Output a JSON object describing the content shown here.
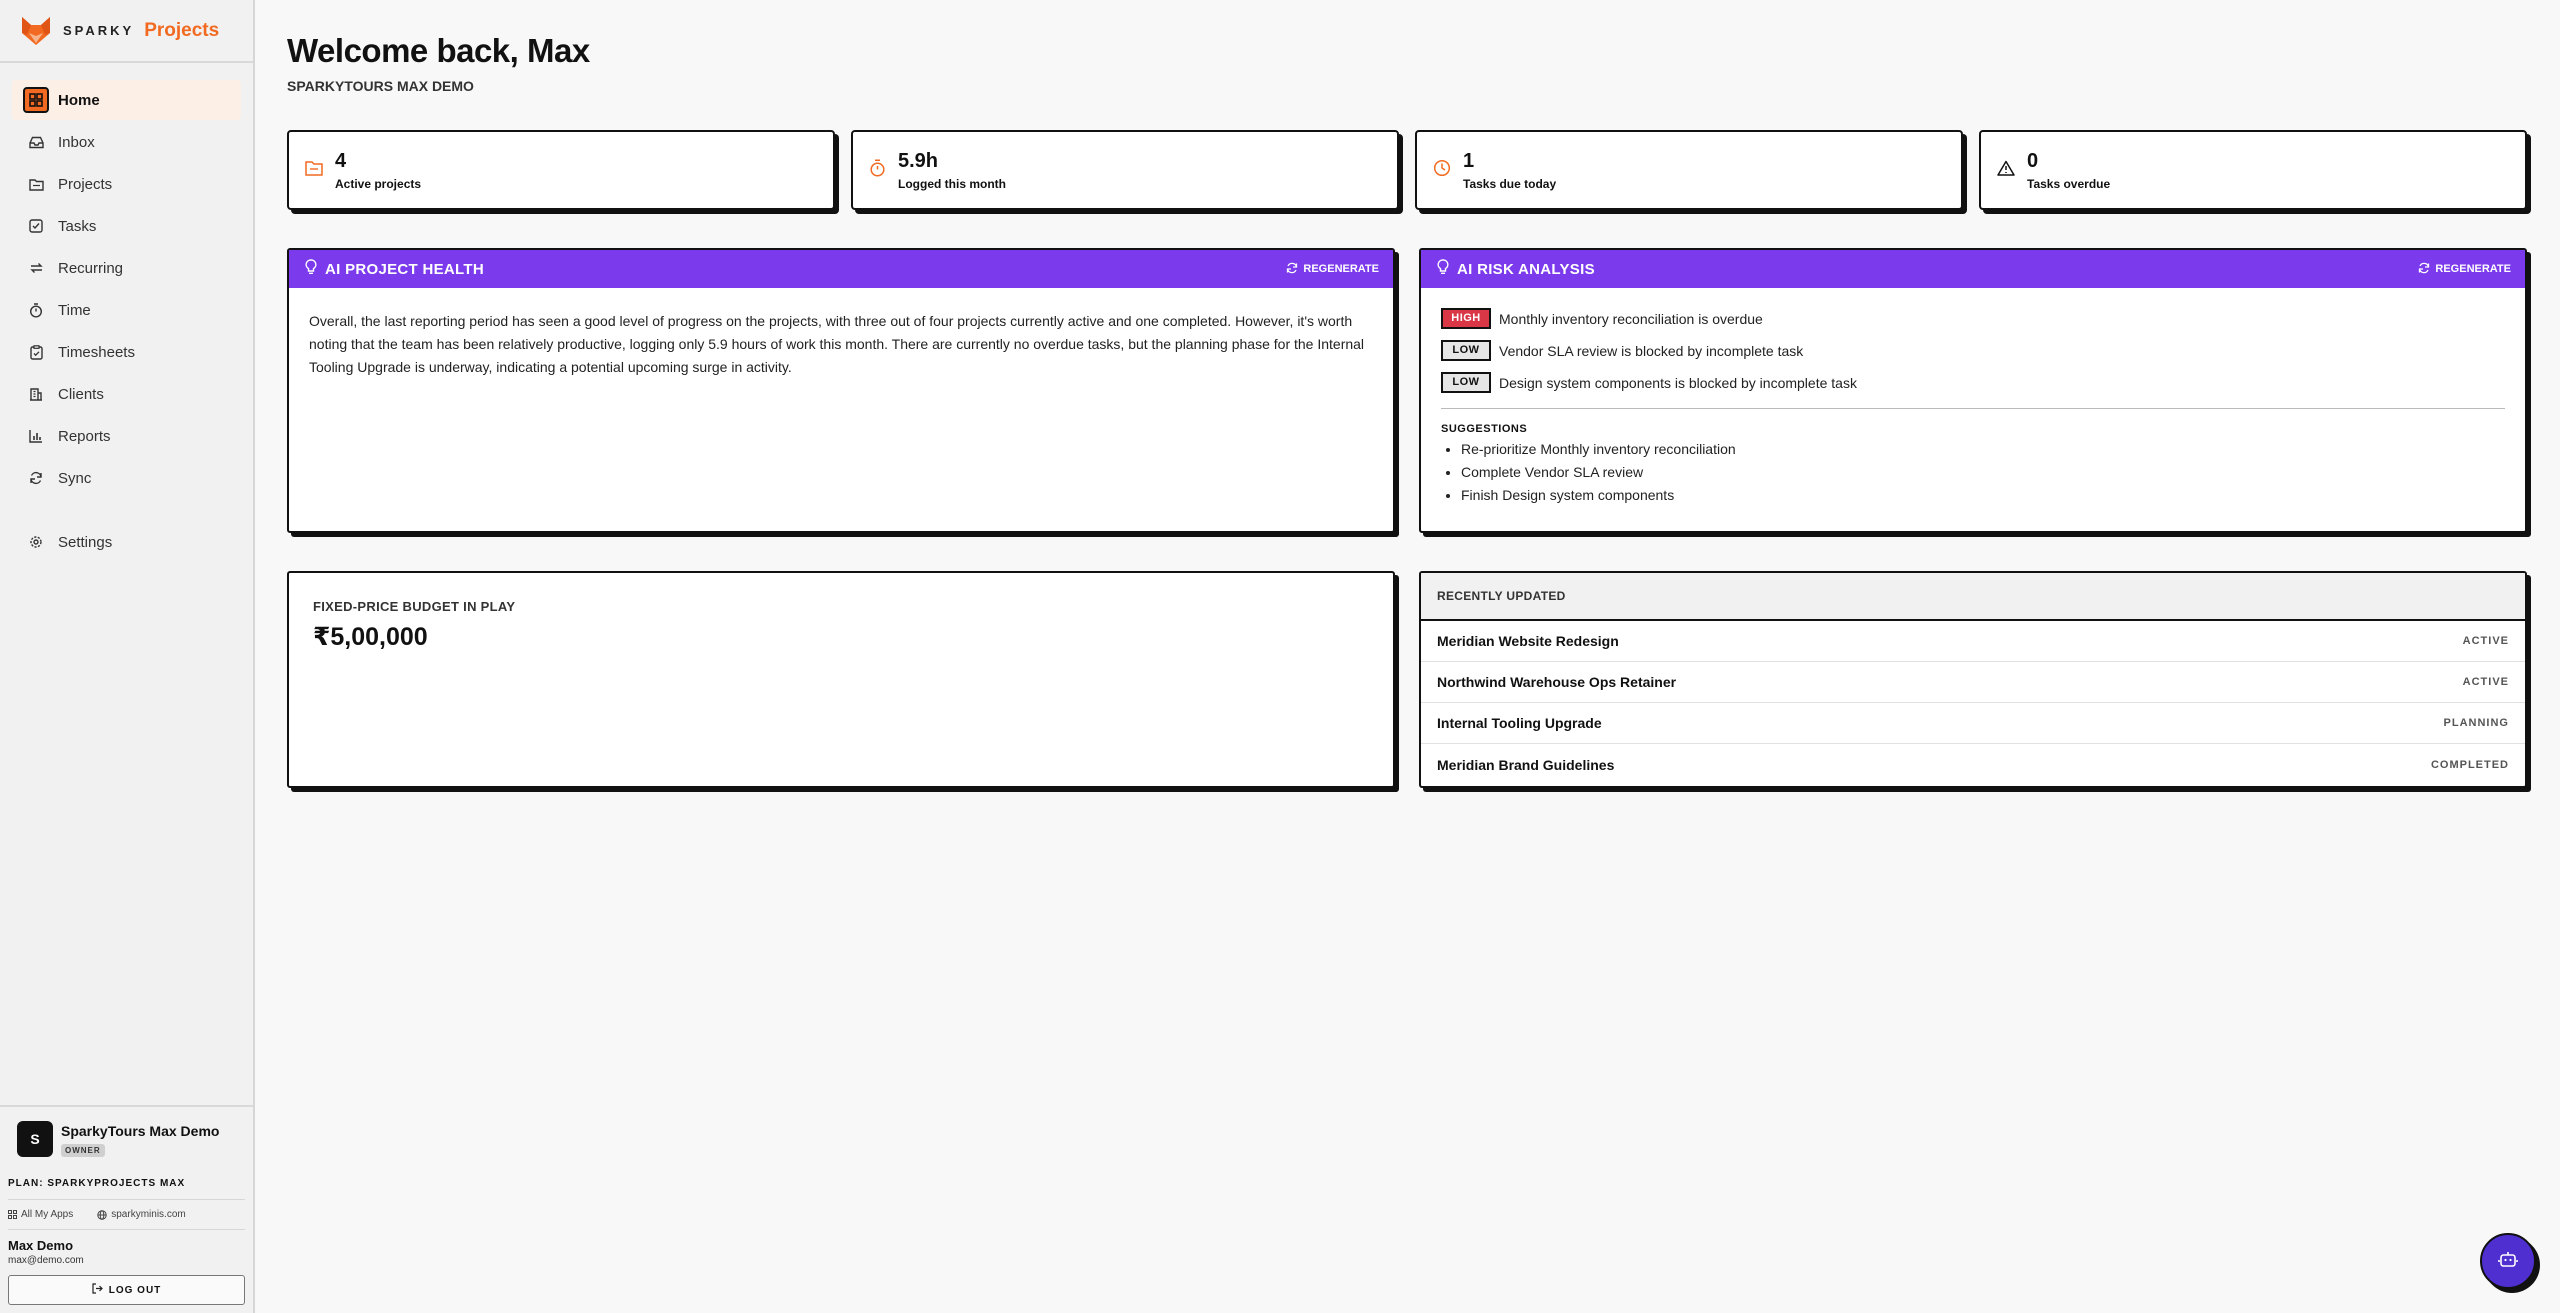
{
  "brand": {
    "sparky": "SPARKY",
    "product": "Projects",
    "logo_icon": "sparky-fox-logo",
    "accent": "#f26a21"
  },
  "nav": [
    {
      "label": "Home",
      "icon": "grid-icon",
      "active": true
    },
    {
      "label": "Inbox",
      "icon": "inbox-icon"
    },
    {
      "label": "Projects",
      "icon": "folder-icon"
    },
    {
      "label": "Tasks",
      "icon": "checkbox-icon"
    },
    {
      "label": "Recurring",
      "icon": "repeat-icon"
    },
    {
      "label": "Time",
      "icon": "stopwatch-icon"
    },
    {
      "label": "Timesheets",
      "icon": "clipboard-icon"
    },
    {
      "label": "Clients",
      "icon": "building-icon"
    },
    {
      "label": "Reports",
      "icon": "bar-chart-icon"
    },
    {
      "label": "Sync",
      "icon": "sync-icon"
    }
  ],
  "settings": {
    "label": "Settings",
    "icon": "gear-icon"
  },
  "org": {
    "initial": "S",
    "name": "SparkyTours Max Demo",
    "role": "OWNER"
  },
  "plan": "PLAN: SPARKYPROJECTS MAX",
  "links": {
    "all_apps": "All My Apps",
    "site": "sparkyminis.com"
  },
  "user": {
    "name": "Max Demo",
    "email": "max@demo.com"
  },
  "logout_label": "LOG OUT",
  "header": {
    "title": "Welcome back, Max",
    "subtitle": "SPARKYTOURS MAX DEMO"
  },
  "stats": [
    {
      "value": "4",
      "label": "Active projects",
      "icon": "folder-icon"
    },
    {
      "value": "5.9h",
      "label": "Logged this month",
      "icon": "stopwatch-icon"
    },
    {
      "value": "1",
      "label": "Tasks due today",
      "icon": "clock-icon"
    },
    {
      "value": "0",
      "label": "Tasks overdue",
      "icon": "warning-icon"
    }
  ],
  "health": {
    "title": "AI PROJECT HEALTH",
    "regenerate": "REGENERATE",
    "text": "Overall, the last reporting period has seen a good level of progress on the projects, with three out of four projects currently active and one completed. However, it's worth noting that the team has been relatively productive, logging only 5.9 hours of work this month. There are currently no overdue tasks, but the planning phase for the Internal Tooling Upgrade is underway, indicating a potential upcoming surge in activity."
  },
  "risk": {
    "title": "AI RISK ANALYSIS",
    "regenerate": "REGENERATE",
    "items": [
      {
        "level": "HIGH",
        "text": "Monthly inventory reconciliation is overdue"
      },
      {
        "level": "LOW",
        "text": "Vendor SLA review is blocked by incomplete task"
      },
      {
        "level": "LOW",
        "text": "Design system components is blocked by incomplete task"
      }
    ],
    "suggestions_title": "SUGGESTIONS",
    "suggestions": [
      "Re-prioritize Monthly inventory reconciliation",
      "Complete Vendor SLA review",
      "Finish Design system components"
    ]
  },
  "budget": {
    "label": "FIXED-PRICE BUDGET IN PLAY",
    "value": "₹5,00,000"
  },
  "recent": {
    "title": "RECENTLY UPDATED",
    "rows": [
      {
        "name": "Meridian Website Redesign",
        "status": "ACTIVE"
      },
      {
        "name": "Northwind Warehouse Ops Retainer",
        "status": "ACTIVE"
      },
      {
        "name": "Internal Tooling Upgrade",
        "status": "PLANNING"
      },
      {
        "name": "Meridian Brand Guidelines",
        "status": "COMPLETED"
      }
    ]
  },
  "fab_icon": "robot-icon",
  "colors": {
    "purple": "#7c3aed",
    "high": "#d93646",
    "fab": "#4f2fd0"
  }
}
